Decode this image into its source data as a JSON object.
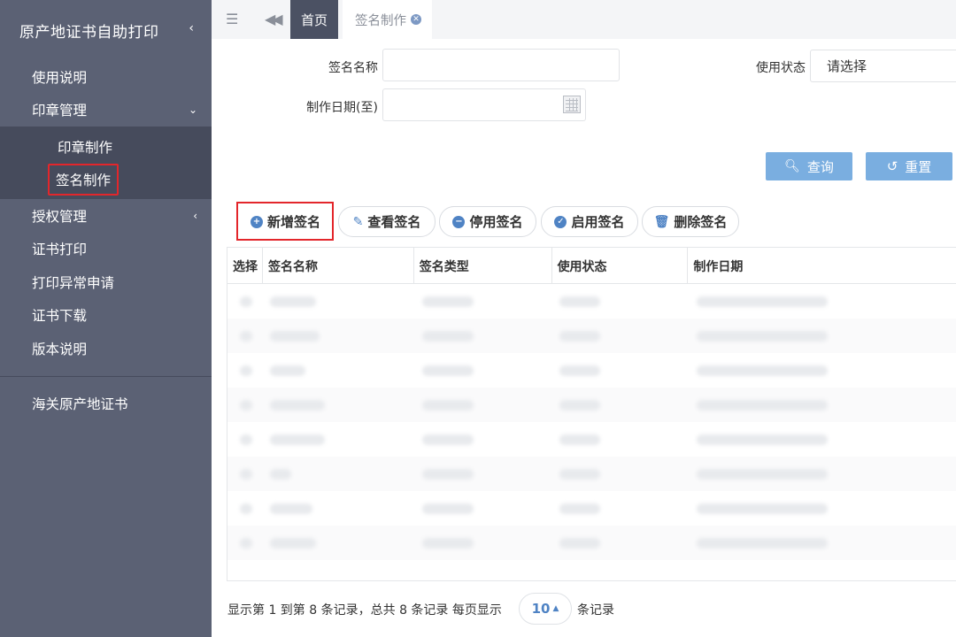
{
  "sidebar": {
    "title": "原产地证书自助打印",
    "items": [
      {
        "label": "使用说明"
      },
      {
        "label": "印章管理",
        "expanded": true,
        "children": [
          {
            "label": "印章制作"
          },
          {
            "label": "签名制作",
            "active": true
          }
        ]
      },
      {
        "label": "授权管理"
      },
      {
        "label": "证书打印"
      },
      {
        "label": "打印异常申请"
      },
      {
        "label": "证书下载"
      },
      {
        "label": "版本说明"
      }
    ],
    "footer_item": "海关原产地证书"
  },
  "tabs": [
    {
      "label": "首页",
      "active": true
    },
    {
      "label": "签名制作",
      "closable": true
    }
  ],
  "form": {
    "name_label": "签名名称",
    "name_value": "",
    "status_label": "使用状态",
    "status_value": "请选择",
    "date_label": "制作日期(至)",
    "date_value": ""
  },
  "buttons": {
    "search": "查询",
    "reset": "重置"
  },
  "actions": [
    {
      "label": "新增签名",
      "icon": "plus-circle-icon"
    },
    {
      "label": "查看签名",
      "icon": "pencil-icon"
    },
    {
      "label": "停用签名",
      "icon": "minus-circle-icon"
    },
    {
      "label": "启用签名",
      "icon": "check-circle-icon"
    },
    {
      "label": "删除签名",
      "icon": "trash-icon"
    }
  ],
  "table": {
    "columns": [
      "选择",
      "签名名称",
      "签名类型",
      "使用状态",
      "制作日期"
    ],
    "row_count": 8
  },
  "pagination": {
    "summary": "显示第 1 到第 8 条记录，总共 8 条记录 每页显示",
    "page_size": "10",
    "suffix": "条记录"
  },
  "colors": {
    "sidebar_bg": "#5b6174",
    "highlight": "#e3262b",
    "accent": "#7aaee0",
    "icon_blue": "#4f83c4"
  }
}
